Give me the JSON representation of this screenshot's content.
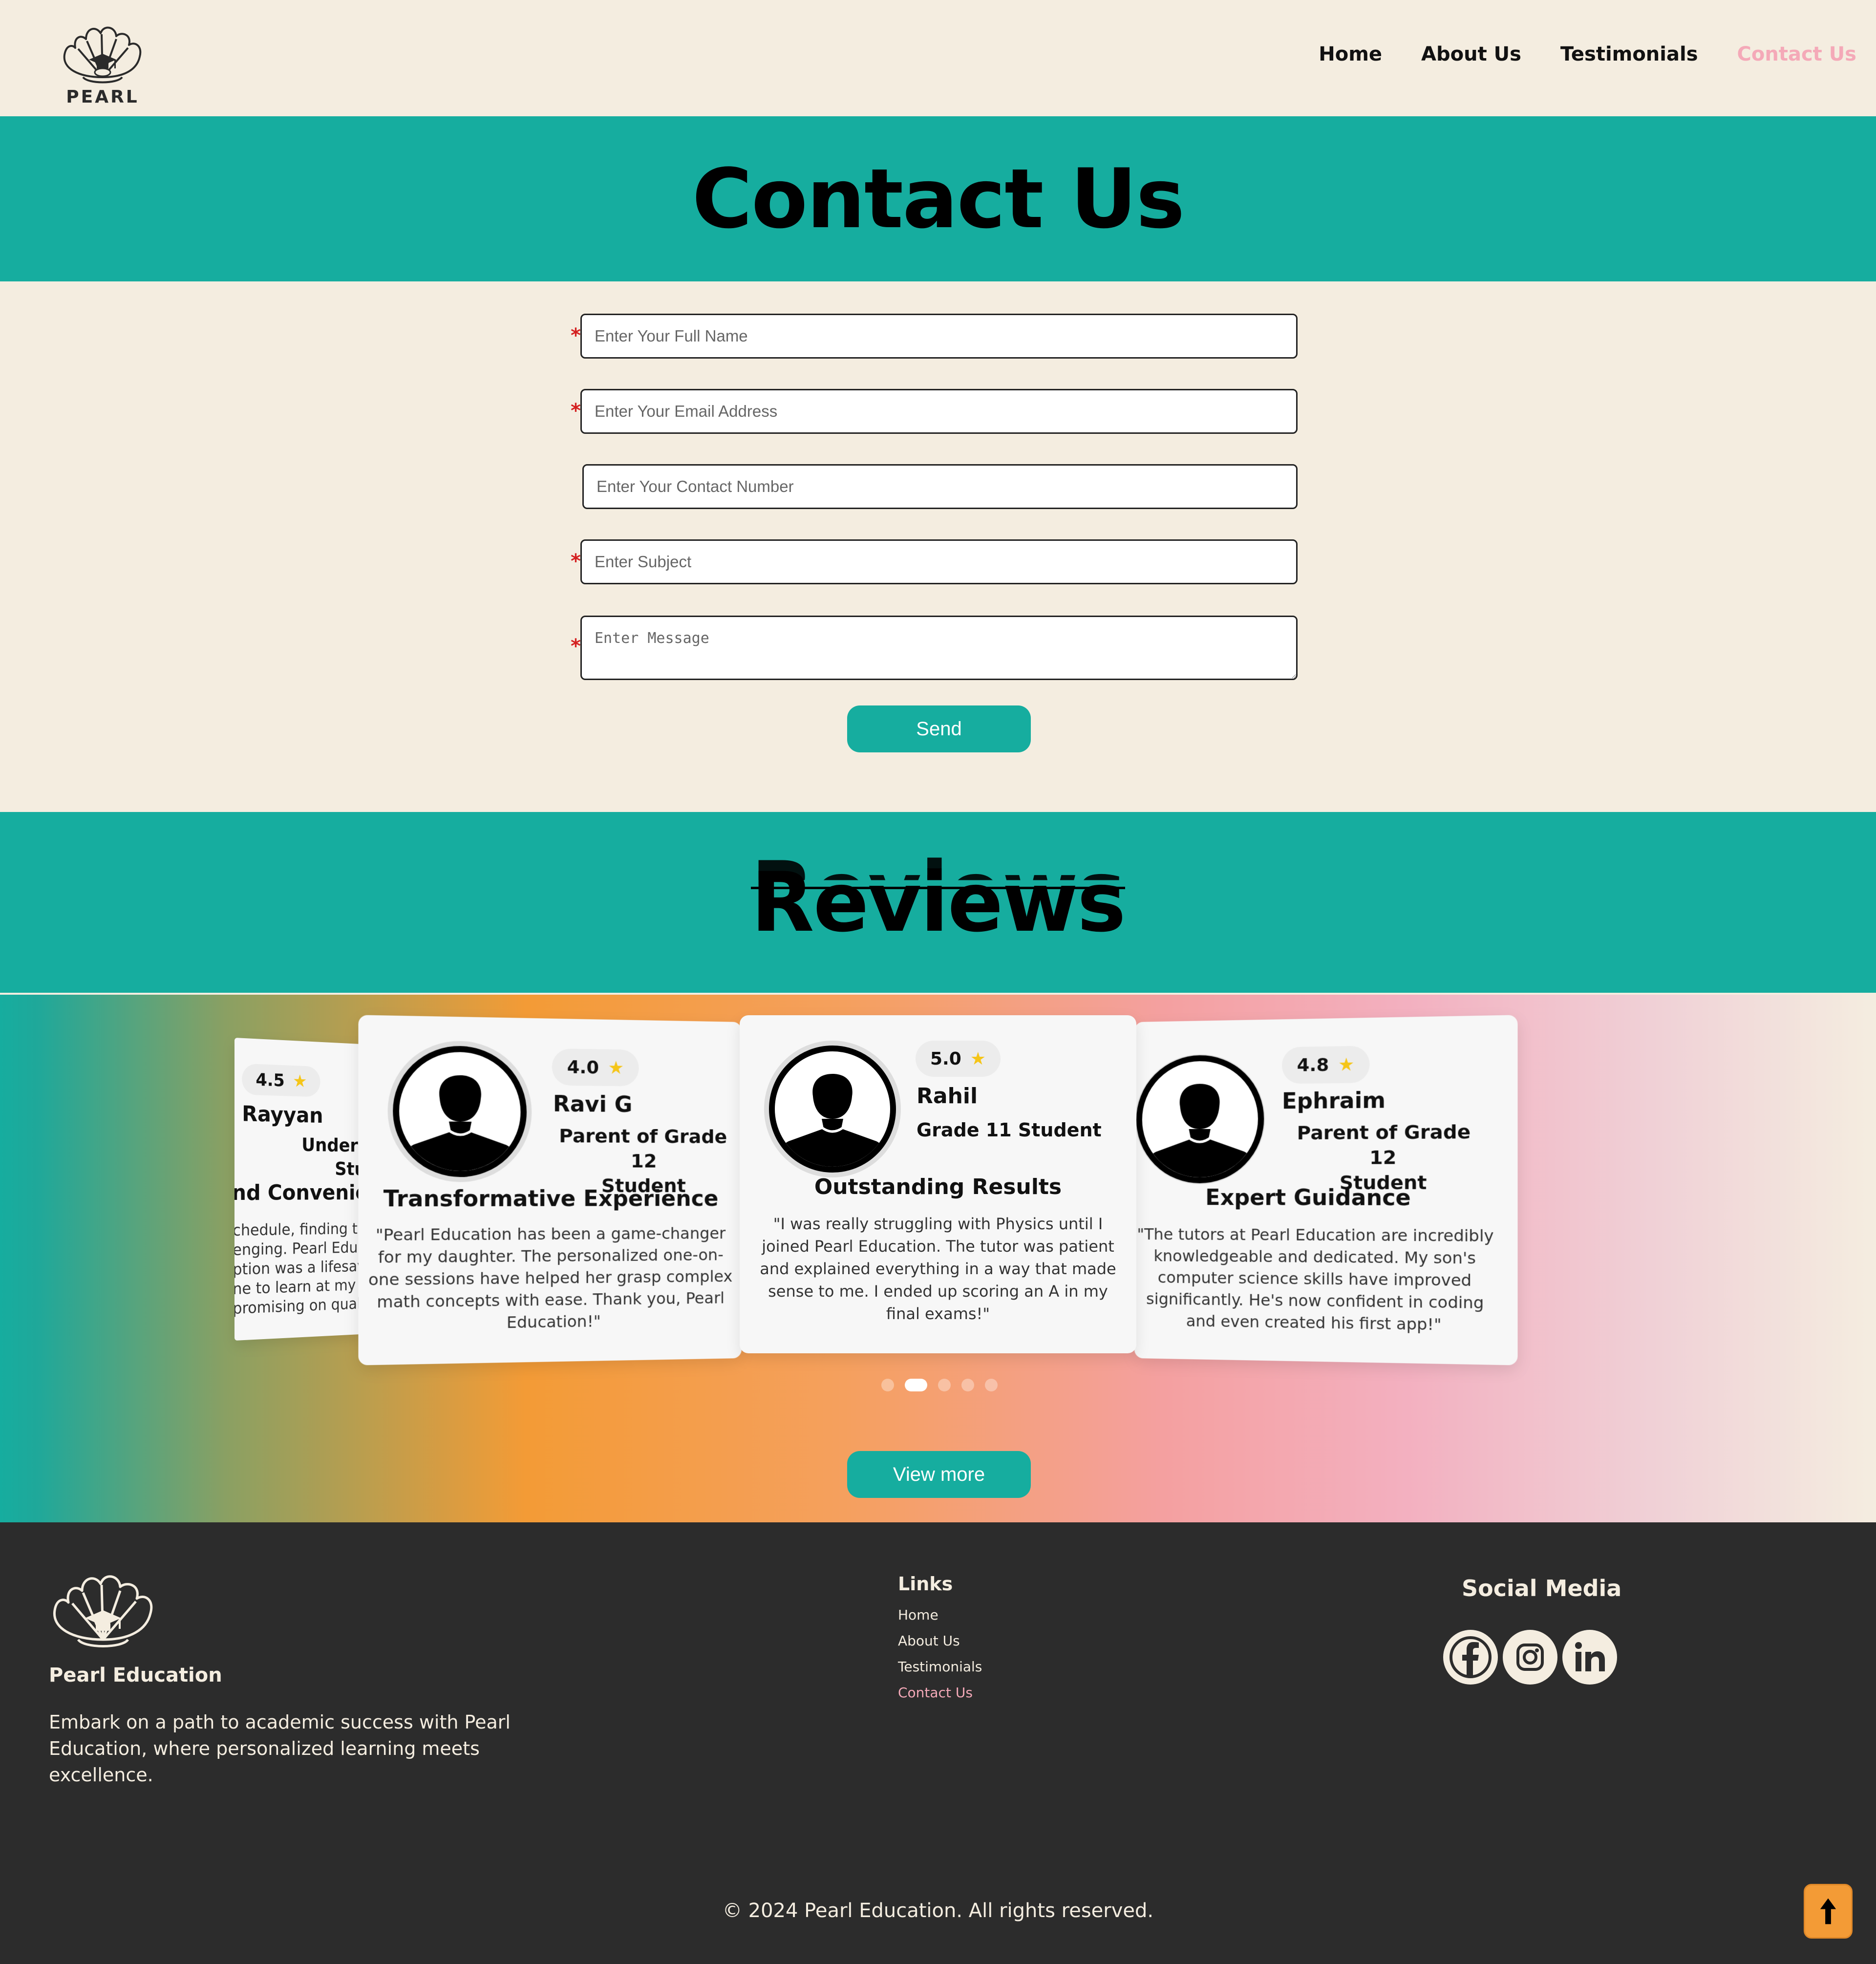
{
  "header": {
    "logo_text": "PEARL",
    "nav": [
      {
        "label": "Home"
      },
      {
        "label": "About Us"
      },
      {
        "label": "Testimonials"
      },
      {
        "label": "Contact Us",
        "active": true
      }
    ]
  },
  "contact": {
    "title": "Contact Us",
    "fields": {
      "name_placeholder": "Enter Your Full Name",
      "email_placeholder": "Enter Your Email Address",
      "phone_placeholder": "Enter Your Contact Number",
      "subject_placeholder": "Enter Subject",
      "message_placeholder": "Enter Message"
    },
    "required_mark": "*",
    "send_label": "Send"
  },
  "reviews": {
    "title": "Reviews",
    "cards": [
      {
        "rating": "4.5",
        "name": "Rayyan",
        "role_line1": "Undergrad",
        "role_line2": "Studen",
        "headline": "nd Convenien",
        "text_lines": [
          "chedule, finding ti",
          "enging. Pearl Edu",
          "ption was a lifesav",
          "ne to learn at my o",
          "promising on qual"
        ]
      },
      {
        "rating": "4.0",
        "name": "Ravi G",
        "role_line1": "Parent of Grade 12",
        "role_line2": "Student",
        "headline": "Transformative Experience",
        "text_lines": [
          "\"Pearl Education has been a game-changer",
          "for my daughter. The personalized one-on-",
          "one sessions have helped her grasp complex",
          "math concepts with ease. Thank you, Pearl",
          "Education!\""
        ]
      },
      {
        "rating": "5.0",
        "name": "Rahil",
        "role_line1": "Grade 11 Student",
        "role_line2": "",
        "headline": "Outstanding Results",
        "text_lines": [
          "\"I was really struggling with Physics until I",
          "joined Pearl Education. The tutor was patient",
          "and explained everything in a way that made",
          "sense to me. I ended up scoring an A in my",
          "final exams!\""
        ]
      },
      {
        "rating": "4.8",
        "name": "Ephraim",
        "role_line1": "Parent of Grade 12",
        "role_line2": "Student",
        "headline": "Expert Guidance",
        "text_lines": [
          "\"The tutors at Pearl Education are incredibly",
          "knowledgeable and dedicated. My son's",
          "computer science skills have improved",
          "significantly. He's now confident in coding",
          "and even created his first app!\""
        ]
      }
    ],
    "star": "★",
    "carousel": {
      "count": 5,
      "active_index": 1
    },
    "view_more_label": "View more"
  },
  "footer": {
    "brand": "Pearl Education",
    "description": "Embark on a path to academic success with Pearl Education, where personalized learning meets excellence.",
    "links_title": "Links",
    "links": [
      {
        "label": "Home"
      },
      {
        "label": "About Us"
      },
      {
        "label": "Testimonials"
      },
      {
        "label": "Contact Us",
        "active": true
      }
    ],
    "social_title": "Social Media",
    "social": [
      {
        "icon": "facebook-icon"
      },
      {
        "icon": "instagram-icon"
      },
      {
        "icon": "linkedin-icon"
      }
    ],
    "copyright": "© 2024 Pearl Education. All rights reserved."
  },
  "colors": {
    "teal": "#16ad9f",
    "cream": "#f4ede0",
    "pink_active": "#f4a9b8",
    "footer_bg": "#2c2c2c",
    "orange": "#f39b36",
    "star": "#f5c518",
    "required": "#d42020"
  }
}
